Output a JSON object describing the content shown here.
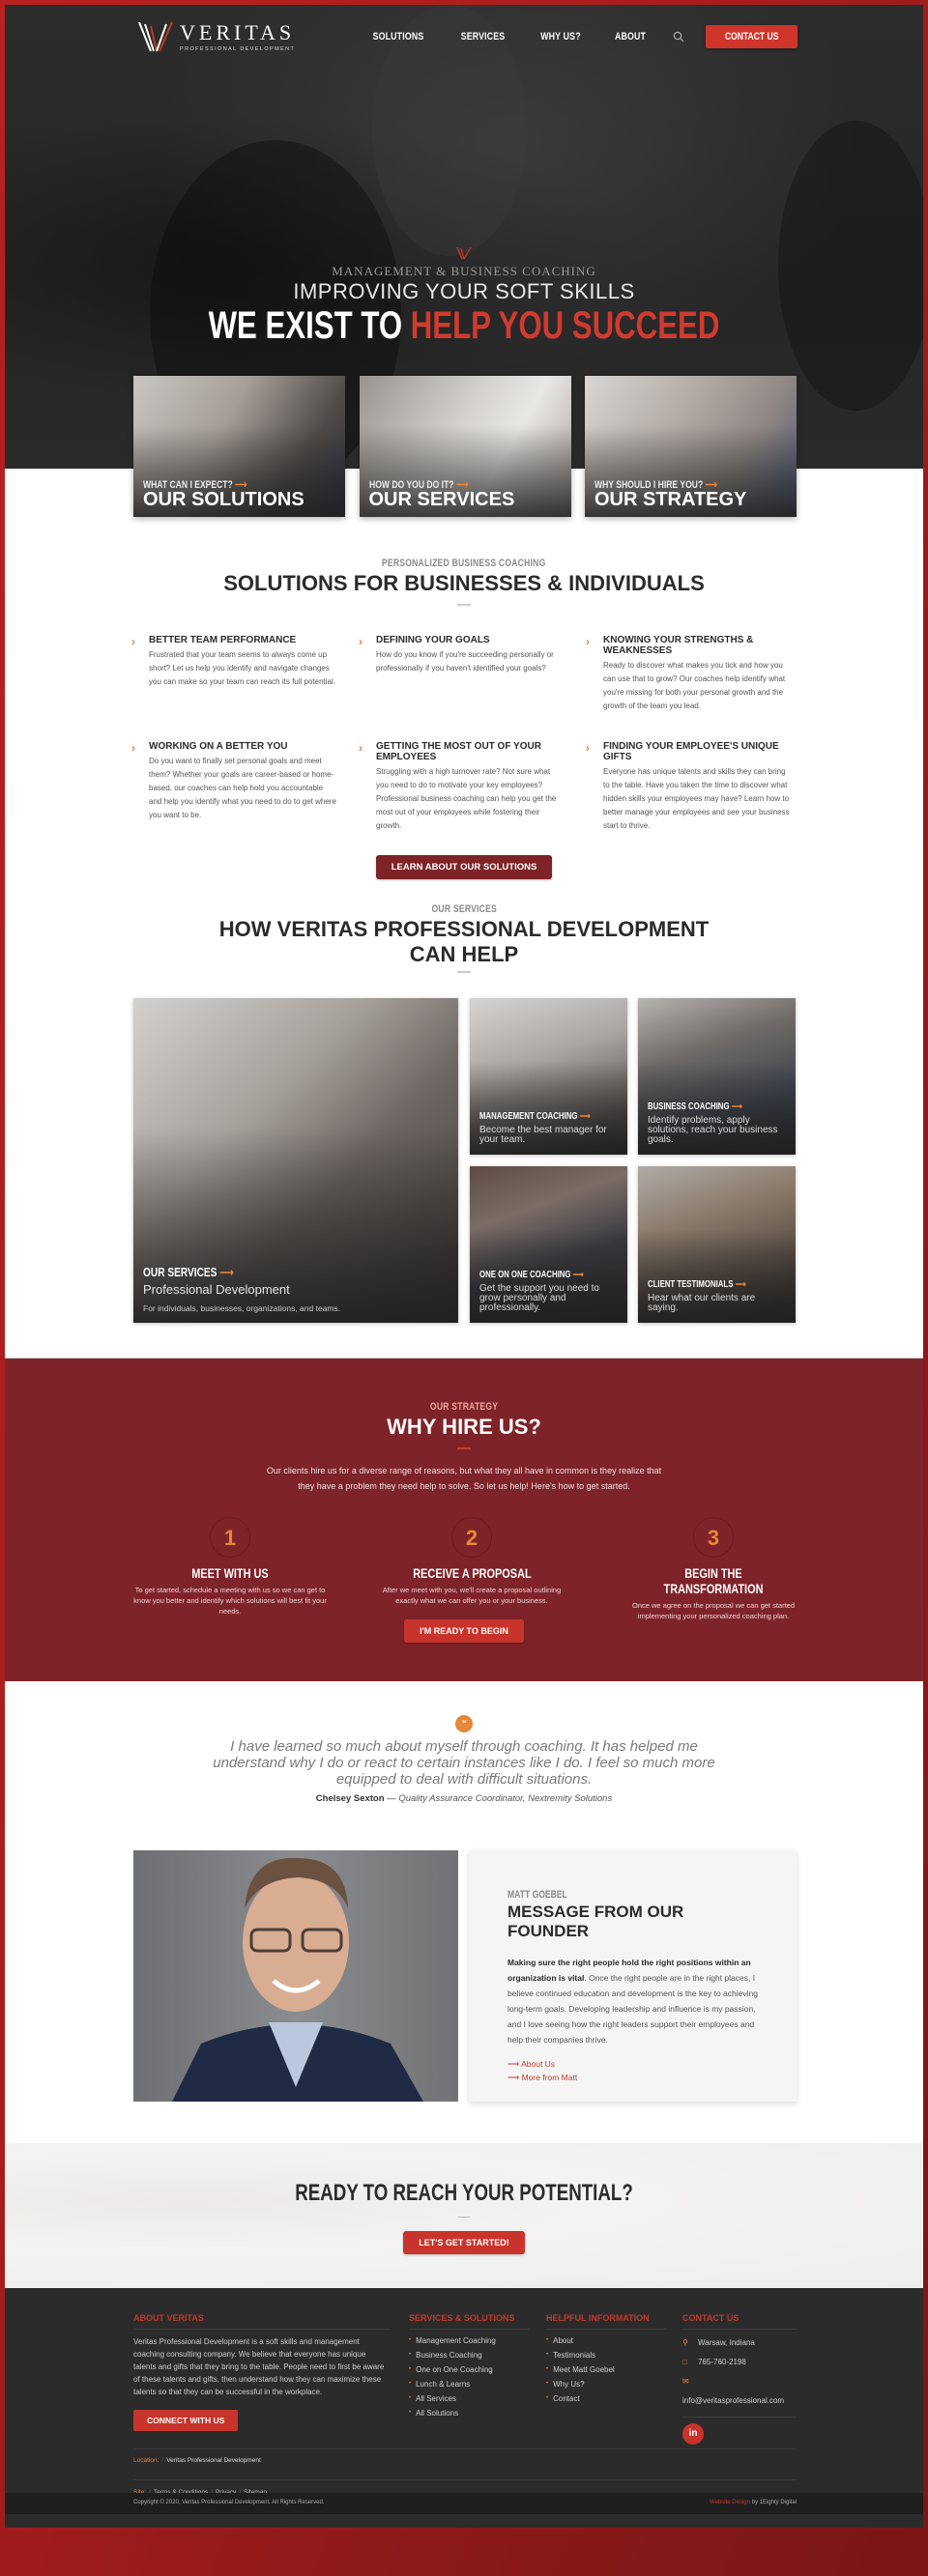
{
  "brand": {
    "name": "VERITAS",
    "tagline": "PROFESSIONAL DEVELOPMENT",
    "accent": "#d0352b",
    "dark_red": "#7e2329",
    "orange": "#e8873a"
  },
  "nav": {
    "items": [
      "SOLUTIONS",
      "SERVICES",
      "WHY US?",
      "ABOUT"
    ],
    "search_icon": "search-icon",
    "contact_label": "CONTACT US"
  },
  "hero": {
    "kicker": "MANAGEMENT & BUSINESS COACHING",
    "subtitle": "IMPROVING YOUR SOFT SKILLS",
    "title_plain": "WE EXIST TO ",
    "title_accent": "HELP YOU SUCCEED"
  },
  "feature_cards": [
    {
      "kicker": "WHAT CAN I EXPECT?",
      "title": "OUR SOLUTIONS"
    },
    {
      "kicker": "HOW DO YOU DO IT?",
      "title": "OUR SERVICES"
    },
    {
      "kicker": "WHY SHOULD I HIRE YOU?",
      "title": "OUR STRATEGY"
    }
  ],
  "solutions": {
    "kicker": "PERSONALIZED BUSINESS COACHING",
    "title": "SOLUTIONS FOR BUSINESSES & INDIVIDUALS",
    "items": [
      {
        "title": "BETTER TEAM PERFORMANCE",
        "text": "Frustrated that your team seems to always come up short? Let us help you identify and navigate changes you can make so your team can reach its full potential."
      },
      {
        "title": "DEFINING YOUR GOALS",
        "text": "How do you know if you're succeeding personally or professionally if you haven't identified your goals?"
      },
      {
        "title": "KNOWING YOUR STRENGTHS & WEAKNESSES",
        "text": "Ready to discover what makes you tick and how you can use that to grow? Our coaches help identify what you're missing for both your personal growth and the growth of the team you lead."
      },
      {
        "title": "WORKING ON A BETTER YOU",
        "text": "Do you want to finally set personal goals and meet them? Whether your goals are career-based or home-based, our coaches can help hold you accountable and help you identify what you need to do to get where you want to be."
      },
      {
        "title": "GETTING THE MOST OUT OF YOUR EMPLOYEES",
        "text": "Struggling with a high turnover rate? Not sure what you need to do to motivate your key employees? Professional business coaching can help you get the most out of your employees while fostering their growth."
      },
      {
        "title": "FINDING YOUR EMPLOYEE'S UNIQUE GIFTS",
        "text": "Everyone has unique talents and skills they can bring to the table. Have you taken the time to discover what hidden skills your employees may have? Learn how to better manage your employees and see your business start to thrive."
      }
    ],
    "button": "LEARN ABOUT OUR SOLUTIONS"
  },
  "services": {
    "kicker": "OUR SERVICES",
    "title_line1": "HOW VERITAS PROFESSIONAL DEVELOPMENT",
    "title_line2": "CAN HELP",
    "main": {
      "title": "OUR SERVICES",
      "subtitle": "Professional Development",
      "text": "For individuals, businesses, organizations, and teams."
    },
    "tiles": [
      {
        "title": "MANAGEMENT COACHING",
        "text": "Become the best manager for your team."
      },
      {
        "title": "BUSINESS COACHING",
        "text": "Identify problems, apply solutions, reach your business goals."
      },
      {
        "title": "ONE ON ONE COACHING",
        "text": "Get the support you need to grow personally and professionally."
      },
      {
        "title": "CLIENT TESTIMONIALS",
        "text": "Hear what our clients are saying."
      }
    ]
  },
  "why": {
    "kicker": "OUR STRATEGY",
    "title": "WHY HIRE US?",
    "intro_line1": "Our clients hire us for a diverse range of reasons, but what they all have in common is they realize that",
    "intro_line2": "they have a problem they need help to solve. So let us help! Here's how to get started.",
    "steps": [
      {
        "num": "1",
        "title": "MEET WITH US",
        "text": "To get started, schedule a meeting with us so we can get to know you better and identify which solutions will best fit your needs."
      },
      {
        "num": "2",
        "title": "RECEIVE A PROPOSAL",
        "text": "After we meet with you, we'll create a proposal outlining exactly what we can offer you or your business."
      },
      {
        "num": "3",
        "title": "BEGIN THE TRANSFORMATION",
        "text": "Once we agree on the proposal we can get started implementing your personalized coaching plan."
      }
    ],
    "button": "I'M READY TO BEGIN"
  },
  "testimonial": {
    "badge": "“",
    "quote": "I have learned so much about myself through coaching. It has helped me understand why I do or react to certain instances like I do. I feel so much more equipped to deal with difficult situations.",
    "author": "Chelsey Sexton",
    "dash": " — ",
    "role": "Quality Assurance Coordinator, Nextremity Solutions"
  },
  "founder": {
    "kicker": "MATT GOEBEL",
    "title": "MESSAGE FROM OUR FOUNDER",
    "bold": "Making sure the right people hold the right positions within an organization is vital",
    "text": ". Once the right people are in the right places, I believe continued education and development is the key to achieving long-term goals. Developing leadership and influence is my passion, and I love seeing how the right leaders support their employees and help their companies thrive.",
    "links": [
      "About Us",
      "More from Matt"
    ]
  },
  "cta": {
    "title": "READY TO REACH YOUR POTENTIAL?",
    "button": "LET'S GET STARTED!"
  },
  "footer": {
    "about": {
      "heading": "ABOUT VERITAS",
      "text": "Veritas Professional Development is a soft skills and management coaching consulting company. We believe that everyone has unique talents and gifts that they bring to the table. People need to first be aware of these talents and gifts, then understand how they can maximize these talents so that they can be successful in the workplace.",
      "button": "CONNECT WITH US"
    },
    "services": {
      "heading": "SERVICES & SOLUTIONS",
      "items": [
        "Management Coaching",
        "Business Coaching",
        "One on One Coaching",
        "Lunch & Learns",
        "All Services",
        "All Solutions"
      ]
    },
    "helpful": {
      "heading": "HELPFUL INFORMATION",
      "items": [
        "About",
        "Testimonials",
        "Meet Matt Goebel",
        "Why Us?",
        "Contact"
      ]
    },
    "contact": {
      "heading": "CONTACT US",
      "location": "Warsaw, Indiana",
      "phone": "765-760-2198",
      "email": "info@veritasprofessional.com",
      "social": "in"
    },
    "location_label": "Location:",
    "location_value": "Veritas Professional Development",
    "site_label": "Site:",
    "site_links": [
      "Terms & Conditions",
      "Privacy",
      "Sitemap"
    ],
    "copyright": "Copyright © 2020, Veritas Professional Development. All Rights Reserved.",
    "credit_link": "Website Design",
    "credit_by": " by 1Eighty Digital"
  }
}
